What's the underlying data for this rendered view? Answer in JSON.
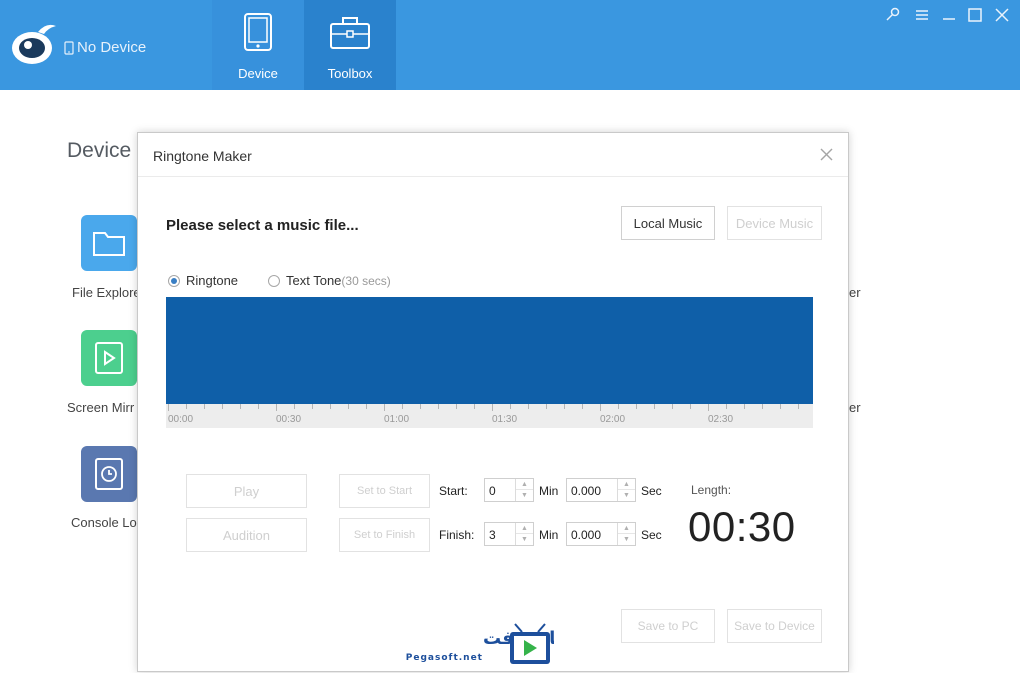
{
  "app": {
    "device_status": "No Device",
    "tabs": [
      {
        "label": "Device"
      },
      {
        "label": "Toolbox"
      }
    ],
    "window_controls": [
      "pin-icon",
      "menu-icon",
      "minimize-icon",
      "maximize-icon",
      "close-icon"
    ],
    "brand_color": "#3a97e0"
  },
  "background": {
    "title": "Device",
    "tools": [
      {
        "label": "File Explore",
        "icon": "folder-icon",
        "color": "#4aa8ec"
      },
      {
        "label": "Screen Mirr",
        "icon": "play-icon",
        "color": "#4ccf8e"
      },
      {
        "label": "Console Lo",
        "icon": "clock-icon",
        "color": "#5a78b0"
      }
    ],
    "right_fragments": [
      "er",
      "er"
    ]
  },
  "dialog": {
    "title": "Ringtone Maker",
    "prompt": "Please select a music file...",
    "buttons": {
      "local_music": "Local Music",
      "device_music": "Device Music",
      "play": "Play",
      "audition": "Audition",
      "set_to_start": "Set to Start",
      "set_to_finish": "Set to Finish",
      "save_to_pc": "Save to PC",
      "save_to_device": "Save to Device"
    },
    "tone_type": {
      "ringtone": "Ringtone",
      "text_tone": "Text Tone",
      "text_tone_hint": "(30 secs)",
      "selected": "ringtone"
    },
    "waveform_color": "#0f5fa8",
    "timeline_labels": [
      "00:00",
      "00:30",
      "01:00",
      "01:30",
      "02:00",
      "02:30"
    ],
    "start": {
      "label": "Start:",
      "min": "0",
      "min_unit": "Min",
      "sec": "0.000",
      "sec_unit": "Sec"
    },
    "finish": {
      "label": "Finish:",
      "min": "3",
      "min_unit": "Min",
      "sec": "0.000",
      "sec_unit": "Sec"
    },
    "length_label": "Length:",
    "length_value": "00:30"
  },
  "watermark": {
    "arabic": "بيجا سوفت",
    "latin": "Pegasoft.net"
  }
}
